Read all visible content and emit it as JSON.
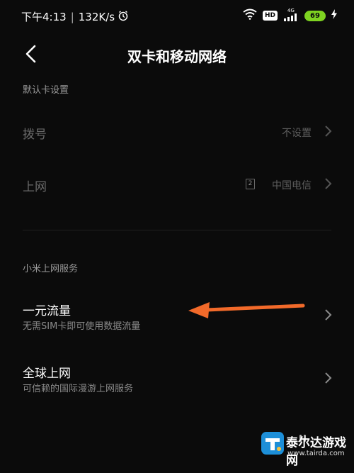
{
  "status_bar": {
    "time": "下午4:13",
    "speed": "132K/s",
    "hd_label": "HD",
    "network_label": "4G",
    "battery_level": "69"
  },
  "header": {
    "title": "双卡和移动网络"
  },
  "sections": {
    "default_card": {
      "label": "默认卡设置",
      "dial": {
        "title": "拨号",
        "value": "不设置"
      },
      "data": {
        "title": "上网",
        "sim_slot": "2",
        "value": "中国电信"
      }
    },
    "xiaomi_services": {
      "label": "小米上网服务",
      "items": [
        {
          "title": "一元流量",
          "subtitle": "无需SIM卡即可使用数据流量"
        },
        {
          "title": "全球上网",
          "subtitle": "可信赖的国际漫游上网服务"
        }
      ]
    }
  },
  "watermark": {
    "name": "泰尔达游戏网",
    "url": "www.tairda.com"
  },
  "colors": {
    "background": "#0b0b0b",
    "arrow": "#f26a2a",
    "battery": "#7ed321"
  }
}
